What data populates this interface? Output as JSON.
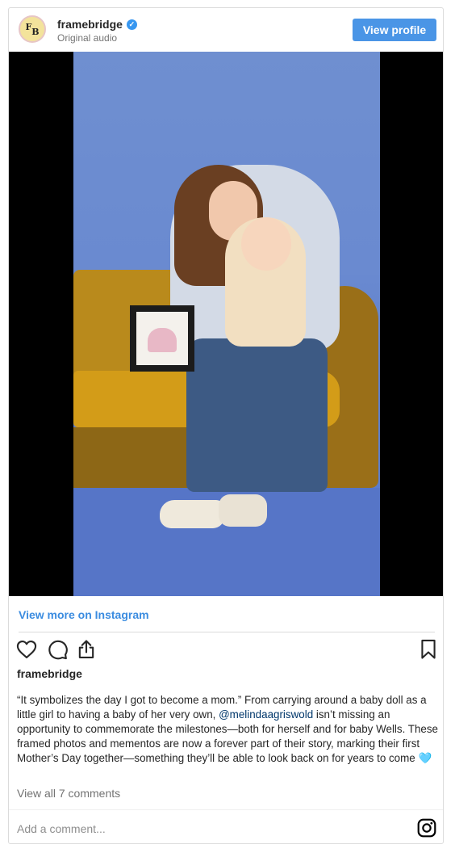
{
  "header": {
    "avatar_text_1": "F",
    "avatar_text_2": "B",
    "username": "framebridge",
    "subtitle": "Original audio",
    "view_profile_label": "View profile"
  },
  "media": {
    "kind": "photo-of-mother-and-baby-on-yellow-sofa"
  },
  "more_link": "View more on Instagram",
  "caption": {
    "username": "framebridge",
    "text_before_mention": "“It symbolizes the day I got to become a mom.” From carrying around a baby doll as a little girl to having a baby of her very own, ",
    "mention": "@melindaagriswold",
    "text_after_mention": " isn’t missing an opportunity to commemorate the milestones—both for herself and for baby Wells. These framed photos and mementos are now a forever part of their story, marking their first Mother’s Day together—something they’ll be able to look back on for years to come ",
    "emoji": "🩵"
  },
  "comments": {
    "view_all_label": "View all 7 comments",
    "add_placeholder": "Add a comment..."
  },
  "colors": {
    "button_blue": "#4a95e6",
    "link_blue": "#3b8ce0",
    "mention_blue": "#00376b",
    "verified_blue": "#3897f0"
  },
  "icons": [
    "verified-badge-icon",
    "heart-icon",
    "comment-icon",
    "share-icon",
    "bookmark-icon",
    "instagram-icon"
  ]
}
